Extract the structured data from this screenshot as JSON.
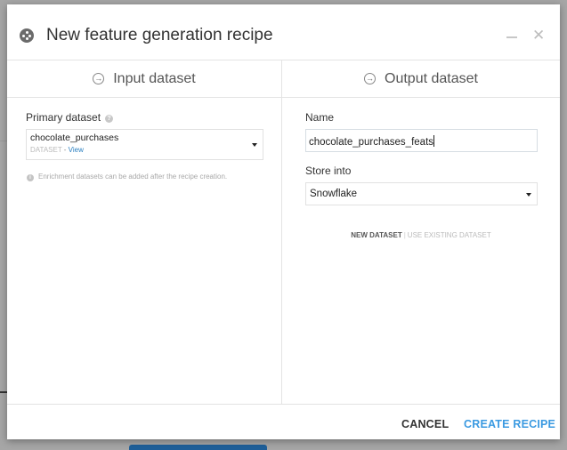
{
  "dialog": {
    "title": "New feature generation recipe",
    "icon": "recipe-icon",
    "minimize_icon": "minimize-icon",
    "close_icon": "close-icon",
    "close_glyph": "✕"
  },
  "input": {
    "header": "Input dataset",
    "header_icon": "arrow-in-icon",
    "primary_label": "Primary dataset",
    "primary_help": "?",
    "primary_value": "chocolate_purchases",
    "primary_type": "DATASET",
    "primary_sep": " - ",
    "primary_link": "View",
    "info_glyph": "i",
    "info_text": "Enrichment datasets can be added after the recipe creation."
  },
  "output": {
    "header": "Output dataset",
    "header_icon": "arrow-in-icon",
    "name_label": "Name",
    "name_value": "chocolate_purchases_feats",
    "store_label": "Store into",
    "store_value": "Snowflake",
    "mode_new": "NEW DATASET",
    "mode_sep": "|",
    "mode_existing": "USE EXISTING DATASET"
  },
  "footer": {
    "cancel": "CANCEL",
    "create": "CREATE RECIPE"
  },
  "colors": {
    "accent": "#3b9ae1",
    "link": "#2a7fc0"
  }
}
